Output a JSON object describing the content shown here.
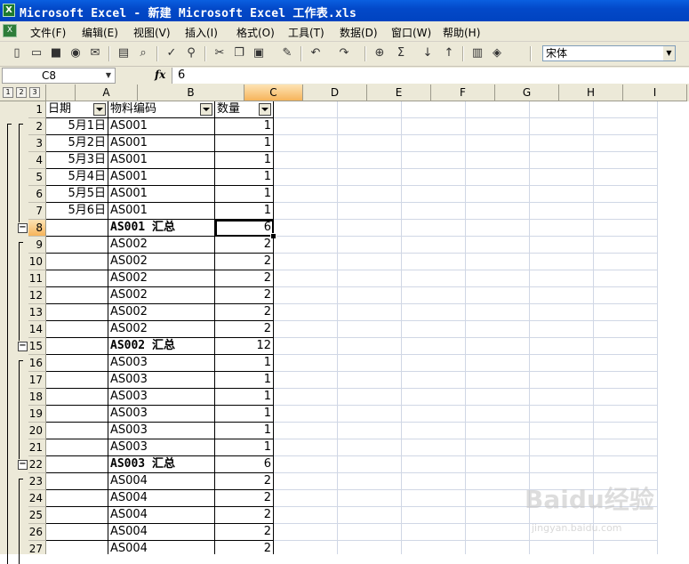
{
  "window": {
    "title": "Microsoft Excel - 新建 Microsoft Excel 工作表.xls"
  },
  "menu": [
    "文件(F)",
    "编辑(E)",
    "视图(V)",
    "插入(I)",
    "格式(O)",
    "工具(T)",
    "数据(D)",
    "窗口(W)",
    "帮助(H)"
  ],
  "toolbar": {
    "font": "宋体"
  },
  "formula_bar": {
    "name_box": "C8",
    "fx_label": "fx",
    "formula": "6"
  },
  "outline_levels": [
    "1",
    "2",
    "3"
  ],
  "columns": [
    "A",
    "B",
    "C",
    "D",
    "E",
    "F",
    "G",
    "H",
    "I"
  ],
  "active_cell": "C8",
  "rows": [
    {
      "n": "1",
      "a": "日期",
      "b": "物料编码",
      "c": "数量",
      "type": "header"
    },
    {
      "n": "2",
      "a": "5月1日",
      "b": "AS001",
      "c": "1"
    },
    {
      "n": "3",
      "a": "5月2日",
      "b": "AS001",
      "c": "1"
    },
    {
      "n": "4",
      "a": "5月3日",
      "b": "AS001",
      "c": "1"
    },
    {
      "n": "5",
      "a": "5月4日",
      "b": "AS001",
      "c": "1"
    },
    {
      "n": "6",
      "a": "5月5日",
      "b": "AS001",
      "c": "1"
    },
    {
      "n": "7",
      "a": "5月6日",
      "b": "AS001",
      "c": "1"
    },
    {
      "n": "8",
      "a": "",
      "b": "AS001 汇总",
      "c": "6",
      "type": "subtotal"
    },
    {
      "n": "9",
      "a": "",
      "b": "AS002",
      "c": "2"
    },
    {
      "n": "10",
      "a": "",
      "b": "AS002",
      "c": "2"
    },
    {
      "n": "11",
      "a": "",
      "b": "AS002",
      "c": "2"
    },
    {
      "n": "12",
      "a": "",
      "b": "AS002",
      "c": "2"
    },
    {
      "n": "13",
      "a": "",
      "b": "AS002",
      "c": "2"
    },
    {
      "n": "14",
      "a": "",
      "b": "AS002",
      "c": "2"
    },
    {
      "n": "15",
      "a": "",
      "b": "AS002 汇总",
      "c": "12",
      "type": "subtotal"
    },
    {
      "n": "16",
      "a": "",
      "b": "AS003",
      "c": "1"
    },
    {
      "n": "17",
      "a": "",
      "b": "AS003",
      "c": "1"
    },
    {
      "n": "18",
      "a": "",
      "b": "AS003",
      "c": "1"
    },
    {
      "n": "19",
      "a": "",
      "b": "AS003",
      "c": "1"
    },
    {
      "n": "20",
      "a": "",
      "b": "AS003",
      "c": "1"
    },
    {
      "n": "21",
      "a": "",
      "b": "AS003",
      "c": "1"
    },
    {
      "n": "22",
      "a": "",
      "b": "AS003 汇总",
      "c": "6",
      "type": "subtotal"
    },
    {
      "n": "23",
      "a": "",
      "b": "AS004",
      "c": "2"
    },
    {
      "n": "24",
      "a": "",
      "b": "AS004",
      "c": "2"
    },
    {
      "n": "25",
      "a": "",
      "b": "AS004",
      "c": "2"
    },
    {
      "n": "26",
      "a": "",
      "b": "AS004",
      "c": "2"
    },
    {
      "n": "27",
      "a": "",
      "b": "AS004",
      "c": "2"
    }
  ],
  "watermark": {
    "main": "Baidu经验",
    "sub": "jingyan.baidu.com"
  }
}
